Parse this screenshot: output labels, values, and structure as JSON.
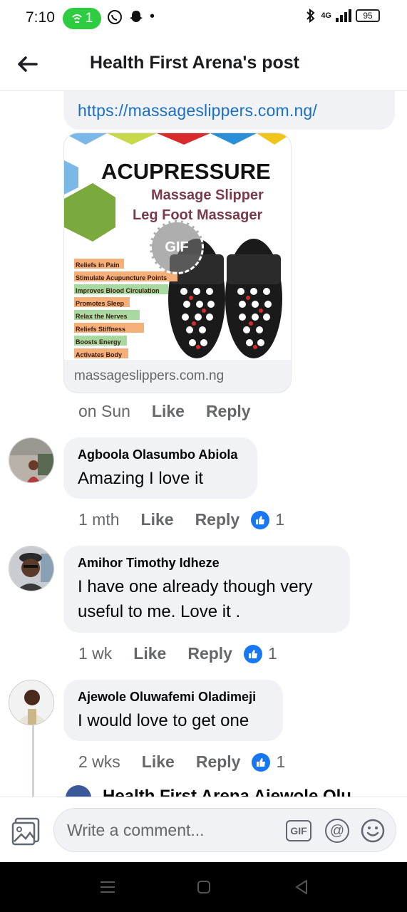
{
  "status_bar": {
    "time": "7:10",
    "hotspot_count": "1",
    "network": "4G",
    "battery": "95"
  },
  "header": {
    "title": "Health First Arena's post"
  },
  "link_comment": {
    "url": "https://massageslippers.com.ng/",
    "preview": {
      "headline": "ACUPRESSURE",
      "subline1": "Massage Slipper",
      "subline2": "Leg Foot Massager",
      "gif_label": "GIF",
      "benefits": [
        "Reliefs in Pain",
        "Stimulate Acupuncture Points",
        "Improves Blood Circulation",
        "Promotes Sleep",
        "Relax the Nerves",
        "Reliefs Stiffness",
        "Boosts Energy",
        "Activates Body"
      ],
      "domain": "massageslippers.com.ng"
    },
    "actions": {
      "time": "on Sun",
      "like": "Like",
      "reply": "Reply"
    }
  },
  "comments": [
    {
      "name": "Agboola Olasumbo Abiola",
      "text": "Amazing I love it",
      "time": "1 mth",
      "like": "Like",
      "reply": "Reply",
      "reactions": "1"
    },
    {
      "name": "Amihor Timothy Idheze",
      "text": "I have one already though very useful to me. Love it .",
      "time": "1 wk",
      "like": "Like",
      "reply": "Reply",
      "reactions": "1"
    },
    {
      "name": "Ajewole Oluwafemi Oladimeji",
      "text": "I would love to get one",
      "time": "2 wks",
      "like": "Like",
      "reply": "Reply",
      "reactions": "1"
    }
  ],
  "partial_reply": {
    "text": "Health First Arena  Ajewole Olu"
  },
  "composer": {
    "placeholder": "Write a comment...",
    "gif": "GIF",
    "mention": "@"
  },
  "colors": {
    "link": "#1a6fc4",
    "like_badge": "#1877f2",
    "bubble": "#f0f2f5",
    "hotspot": "#2ecc40"
  }
}
